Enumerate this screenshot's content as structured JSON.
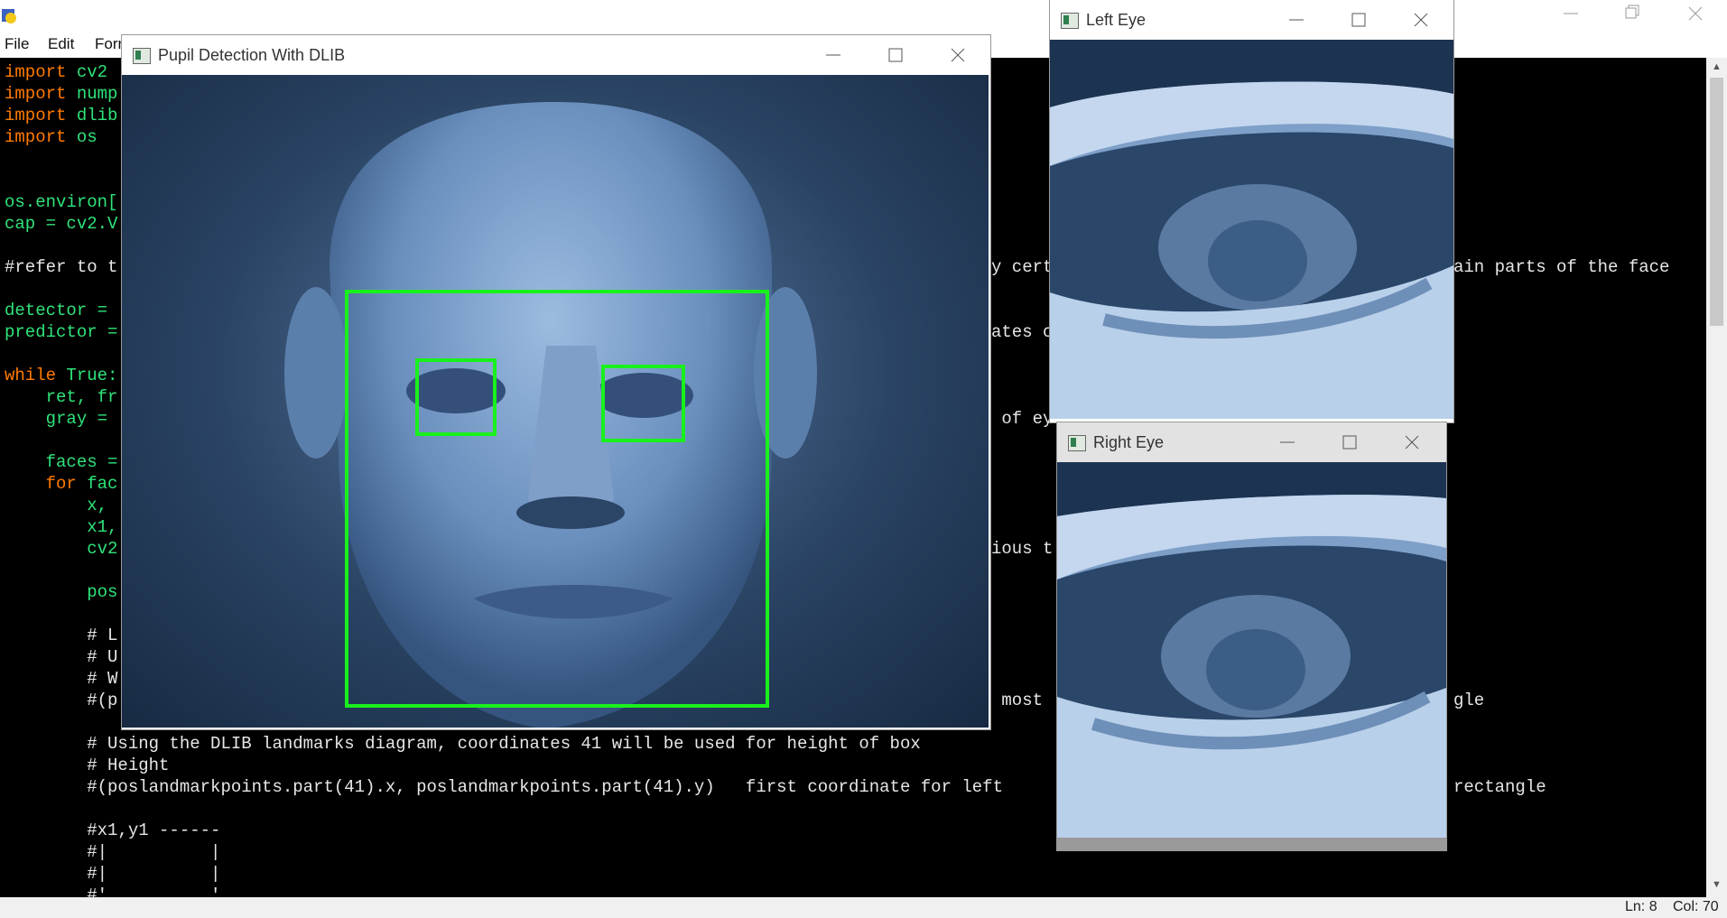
{
  "editor": {
    "menu": [
      "File",
      "Edit",
      "Forr"
    ],
    "status": {
      "line": "Ln: 8",
      "col": "Col: 70"
    },
    "code_lines": [
      {
        "kw": "import",
        "rest": " cv2"
      },
      {
        "kw": "import",
        "rest": " nump"
      },
      {
        "kw": "import",
        "rest": " dlib"
      },
      {
        "kw": "import",
        "rest": " os"
      },
      {
        "kw": "",
        "rest": ""
      },
      {
        "kw": "",
        "rest": ""
      },
      {
        "kw": "",
        "rest": "os.environ["
      },
      {
        "kw": "",
        "rest": "cap = cv2.V"
      },
      {
        "kw": "",
        "rest": ""
      },
      {
        "kw": "",
        "rest": "#refer to t"
      },
      {
        "kw": "",
        "rest": ""
      },
      {
        "kw": "",
        "rest": "detector ="
      },
      {
        "kw": "",
        "rest": "predictor ="
      },
      {
        "kw": "",
        "rest": ""
      },
      {
        "kw": "while",
        "rest": " True:"
      },
      {
        "kw": "",
        "rest": "    ret, fr"
      },
      {
        "kw": "",
        "rest": "    gray ="
      },
      {
        "kw": "",
        "rest": ""
      },
      {
        "kw": "",
        "rest": "    faces ="
      },
      {
        "kw": "    for",
        "rest": " fac"
      },
      {
        "kw": "",
        "rest": "        x,"
      },
      {
        "kw": "",
        "rest": "        x1,"
      },
      {
        "kw": "",
        "rest": "        cv2"
      },
      {
        "kw": "",
        "rest": ""
      },
      {
        "kw": "",
        "rest": "        pos"
      },
      {
        "kw": "",
        "rest": ""
      },
      {
        "kw": "",
        "rest": "        # L"
      },
      {
        "kw": "",
        "rest": "        # U"
      },
      {
        "kw": "",
        "rest": "        # W"
      },
      {
        "kw": "",
        "rest": "        #(p"
      },
      {
        "kw": "",
        "rest": ""
      },
      {
        "kw": "",
        "rest": "        # Using the DLIB landmarks diagram, coordinates 41 will be used for height of box"
      },
      {
        "kw": "",
        "rest": "        # Height"
      },
      {
        "kw": "",
        "rest": "        #(poslandmarkpoints.part(41).x, poslandmarkpoints.part(41).y)   first coordinate for left"
      },
      {
        "kw": "",
        "rest": ""
      },
      {
        "kw": "",
        "rest": "        #x1,y1 ------"
      },
      {
        "kw": "",
        "rest": "        #|          |"
      },
      {
        "kw": "",
        "rest": "        #|          |"
      },
      {
        "kw": "",
        "rest": "        #'          '"
      }
    ],
    "right_fragments": [
      {
        "line": 9,
        "text": "y cert",
        "grn": false
      },
      {
        "line": 9,
        "text": "ain parts of the face",
        "grn": false,
        "far": true
      },
      {
        "line": 12,
        "text": "ates c",
        "grn": false
      },
      {
        "line": 16,
        "text": " of ey",
        "grn": false
      },
      {
        "line": 22,
        "text": "ious t",
        "grn": false
      },
      {
        "line": 29,
        "text": " most",
        "grn": false
      },
      {
        "line": 29,
        "text": "gle",
        "grn": false,
        "far": true
      },
      {
        "line": 33,
        "text": "rectangle",
        "grn": false,
        "far": true
      }
    ]
  },
  "windows": {
    "main": {
      "title": "Pupil Detection With DLIB"
    },
    "left_eye": {
      "title": "Left Eye"
    },
    "right_eye": {
      "title": "Right Eye"
    }
  },
  "icons": {
    "minimize": "minimize-icon",
    "maximize": "maximize-icon",
    "close": "close-icon",
    "restore": "restore-icon"
  },
  "colors": {
    "detection_box": "#19f11c",
    "keyword": "#ff7a00",
    "code_green": "#2fe37a"
  }
}
